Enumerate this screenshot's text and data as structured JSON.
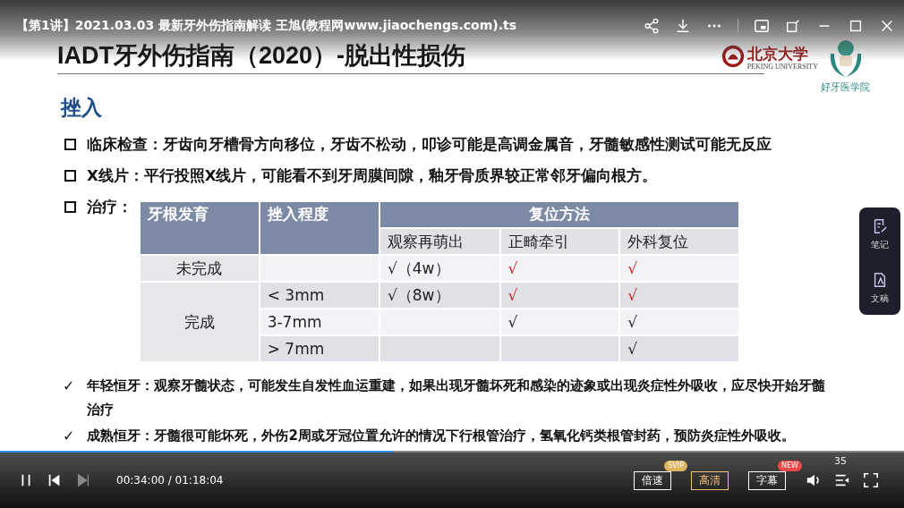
{
  "player": {
    "title": "【第1讲】2021.03.03  最新牙外伤指南解读 王旭(教程网www.jiaochengs.com).ts",
    "progress": {
      "level": 0.435
    },
    "time": "00:34:00 / 01:18:04",
    "paused": false,
    "buttons": [
      {
        "label": "倍速",
        "badge": {
          "text": "SVIP",
          "color": "#e0b45c"
        },
        "selected": false
      },
      {
        "label": "高清",
        "selected": true
      },
      {
        "label": "字幕",
        "badge": {
          "text": "NEW",
          "color": "#f04848"
        },
        "selected": false
      }
    ],
    "side_panel": [
      {
        "kind": "note",
        "label": "笔记"
      },
      {
        "kind": "draft",
        "label": "文稿"
      }
    ]
  },
  "slide": {
    "title": "IADT牙外伤指南（2020）-脱出性损伤",
    "logo": {
      "name": "北京大学",
      "name_en": "PEKING UNIVERSITY",
      "school": "好牙医学院"
    },
    "heading": "挫入",
    "bullets": [
      {
        "text": "临床检查：牙齿向牙槽骨方向移位，牙齿不松动，叩诊可能是高调金属音，牙髓敏感性测试可能无反应"
      },
      {
        "text": "X线片：平行投照X线片，可能看不到牙周膜间隙，釉牙骨质界较正常邻牙偏向根方。"
      },
      {
        "text": "治疗："
      }
    ],
    "table": {
      "columns": [
        "牙根发育",
        "挫入程度",
        "复位方法"
      ],
      "subcolumns": [
        "观察再萌出",
        "正畸牵引",
        "外科复位"
      ],
      "groups": [
        {
          "development": "未完成",
          "rows": [
            {
              "cells": [
                {
                  "text": "√（4w）",
                  "color": "#222222"
                },
                {
                  "text": "√",
                  "color": "#d0202a"
                },
                {
                  "text": "√",
                  "color": "#d0202a"
                }
              ]
            }
          ]
        },
        {
          "development": "完成",
          "rows": [
            {
              "degree": "< 3mm",
              "cells": [
                {
                  "text": "√（8w）",
                  "color": "#222222"
                },
                {
                  "text": "√",
                  "color": "#d0202a"
                },
                {
                  "text": "√",
                  "color": "#d0202a"
                }
              ]
            },
            {
              "degree": "3-7mm",
              "cells": [
                {},
                {
                  "text": "√",
                  "color": "#222222"
                },
                {
                  "text": "√",
                  "color": "#222222"
                }
              ]
            },
            {
              "degree": "> 7mm",
              "cells": [
                {},
                {},
                {
                  "text": "√",
                  "color": "#222222"
                }
              ]
            }
          ]
        }
      ]
    },
    "checks": [
      {
        "mark": "✓",
        "text": "年轻恒牙：观察牙髓状态，可能发生自发性血运重建，如果出现牙髓坏死和感染的迹象或出现炎症性外吸收，应尽快开始牙髓治疗"
      },
      {
        "mark": "✓",
        "text": "成熟恒牙：牙髓很可能坏死，外伤2周或牙冠位置允许的情况下行根管治疗，氢氧化钙类根管封药，预防炎症性外吸收。"
      }
    ],
    "page_number": "35"
  }
}
